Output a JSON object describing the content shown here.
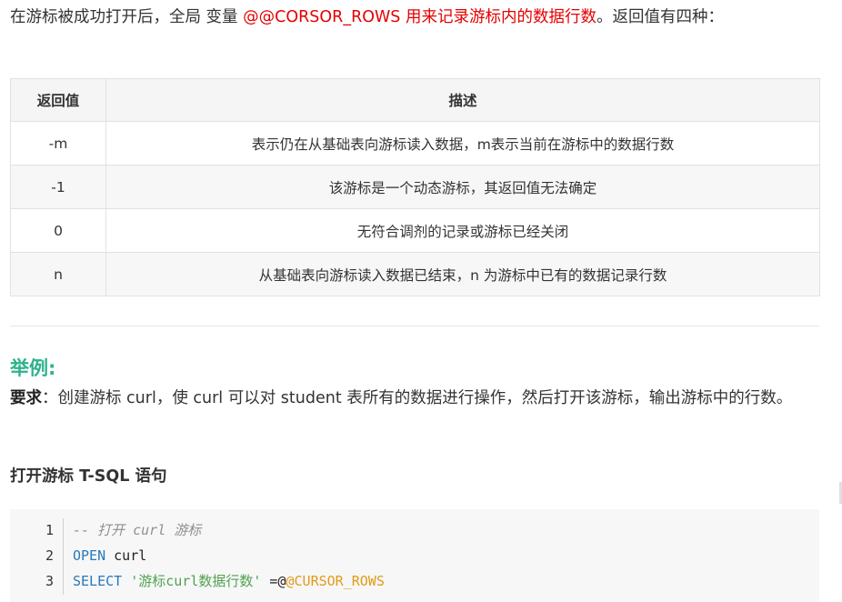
{
  "intro": {
    "prefix": "在游标被成功打开后，全局 变量 ",
    "highlight": "@@CORSOR_ROWS 用来记录游标内的数据行数",
    "suffix": "。返回值有四种："
  },
  "table": {
    "headers": [
      "返回值",
      "描述"
    ],
    "rows": [
      {
        "value": "-m",
        "desc": "表示仍在从基础表向游标读入数据，m表示当前在游标中的数据行数"
      },
      {
        "value": "-1",
        "desc": "该游标是一个动态游标，其返回值无法确定"
      },
      {
        "value": "0",
        "desc": "无符合调剂的记录或游标已经关闭"
      },
      {
        "value": "n",
        "desc": "从基础表向游标读入数据已结束，n 为游标中已有的数据记录行数"
      }
    ]
  },
  "example": {
    "heading": "举例:",
    "requirement_label": "要求",
    "requirement_text": "：创建游标 curl，使 curl 可以对 student 表所有的数据进行操作，然后打开该游标，输出游标中的行数。"
  },
  "code_section": {
    "heading": "打开游标 T-SQL 语句",
    "lines": [
      {
        "number": "1",
        "tokens": [
          {
            "type": "comment",
            "text": "-- 打开 curl 游标"
          }
        ]
      },
      {
        "number": "2",
        "tokens": [
          {
            "type": "kw",
            "text": "OPEN"
          },
          {
            "type": "plain",
            "text": " curl"
          }
        ]
      },
      {
        "number": "3",
        "tokens": [
          {
            "type": "kw",
            "text": "SELECT"
          },
          {
            "type": "plain",
            "text": " "
          },
          {
            "type": "str",
            "text": "'游标curl数据行数'"
          },
          {
            "type": "plain",
            "text": " =@"
          },
          {
            "type": "var",
            "text": "@CURSOR_ROWS"
          }
        ]
      }
    ]
  },
  "colors": {
    "highlight": "#e60000",
    "heading_accent": "#2fb28c",
    "code_keyword": "#2a78b8",
    "code_string": "#50a14f",
    "code_variable": "#e39b16",
    "code_comment": "#8e908c"
  }
}
